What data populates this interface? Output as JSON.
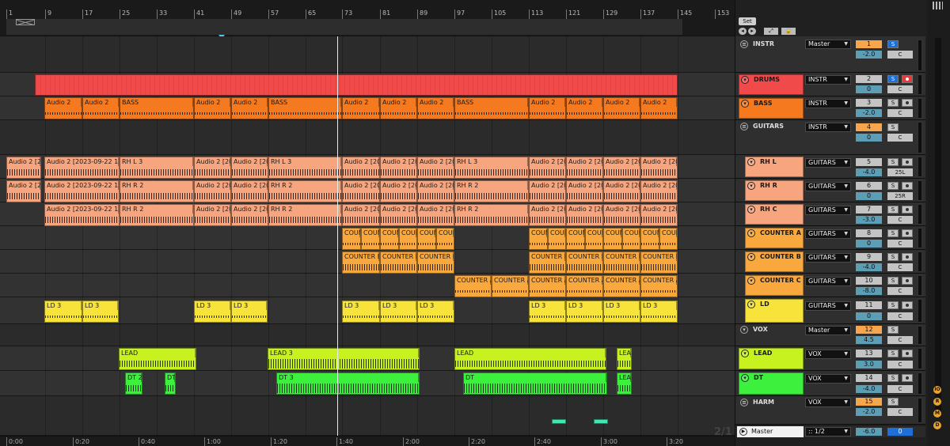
{
  "ruler": {
    "bars": [
      "1",
      "9",
      "17",
      "25",
      "33",
      "41",
      "49",
      "57",
      "65",
      "73",
      "81",
      "89",
      "97",
      "105",
      "113",
      "121",
      "129",
      "137",
      "145",
      "153"
    ]
  },
  "timebar": {
    "times": [
      "0:00",
      "0:20",
      "0:40",
      "1:00",
      "1:20",
      "1:40",
      "2:00",
      "2:20",
      "2:40",
      "3:00",
      "3:20"
    ]
  },
  "pager": "2/1",
  "controls": {
    "set": "Set",
    "prev": "◂",
    "next": "▸",
    "fit": "⤢",
    "lock": "🔒"
  },
  "clips": {
    "audio2": "Audio 2",
    "bass": "BASS",
    "audio2_short": "Audio 2 [2",
    "audio2_date": "Audio 2 [2023-09-22 13",
    "audio2_20": "Audio 2 [20",
    "audio2_20x": "Audio 2 [20",
    "rhl3": "RH L 3",
    "rhr2": "RH R 2",
    "coun": "COUN",
    "counb": "COUNTER B",
    "countera": "COUNTER A",
    "ld3": "LD 3",
    "lead": "LEAD",
    "lead3": "LEAD 3",
    "lea": "LEA",
    "dt2": "DT 2",
    "dt": "DT",
    "dt3": "DT 3"
  },
  "tracks": [
    {
      "name": "INSTR",
      "group": true,
      "color": "#3a3a3a",
      "route": "Master",
      "num": "1",
      "vol": "-2.0",
      "pan": "C",
      "solo_on": true,
      "arm": false
    },
    {
      "name": "DRUMS",
      "group": false,
      "color": "#f04a4a",
      "route": "INSTR",
      "num": "2",
      "vol": "0",
      "pan": "C",
      "solo_on": true,
      "arm": true,
      "rec": true
    },
    {
      "name": "BASS",
      "group": false,
      "color": "#f57a1f",
      "route": "INSTR",
      "num": "3",
      "vol": "-2.0",
      "pan": "C",
      "solo_on": false,
      "arm": true
    },
    {
      "name": "GUITARS",
      "group": true,
      "color": "#3a3a3a",
      "route": "INSTR",
      "num": "4",
      "vol": "0",
      "pan": "C",
      "solo_on": false,
      "arm": false
    },
    {
      "name": "RH L",
      "group": false,
      "color": "#f7a57e",
      "route": "GUITARS",
      "num": "5",
      "vol": "-4.0",
      "pan": "25L",
      "solo_on": false,
      "arm": true
    },
    {
      "name": "RH R",
      "group": false,
      "color": "#f7a57e",
      "route": "GUITARS",
      "num": "6",
      "vol": "0",
      "pan": "25R",
      "solo_on": false,
      "arm": true
    },
    {
      "name": "RH C",
      "group": false,
      "color": "#f7a57e",
      "route": "GUITARS",
      "num": "7",
      "vol": "-3.0",
      "pan": "C",
      "solo_on": false,
      "arm": true
    },
    {
      "name": "COUNTER A",
      "group": false,
      "color": "#f9a83d",
      "route": "GUITARS",
      "num": "8",
      "vol": "0",
      "pan": "C",
      "solo_on": false,
      "arm": true
    },
    {
      "name": "COUNTER B",
      "group": false,
      "color": "#f9a83d",
      "route": "GUITARS",
      "num": "9",
      "vol": "-4.0",
      "pan": "C",
      "solo_on": false,
      "arm": true
    },
    {
      "name": "COUNTER C",
      "group": false,
      "color": "#f9a83d",
      "route": "GUITARS",
      "num": "10",
      "vol": "-8.0",
      "pan": "C",
      "solo_on": false,
      "arm": true
    },
    {
      "name": "LD",
      "group": false,
      "color": "#f7e33a",
      "route": "GUITARS",
      "num": "11",
      "vol": "0",
      "pan": "C",
      "solo_on": false,
      "arm": true
    },
    {
      "name": "VOX",
      "group": true,
      "color": "#3a3a3a",
      "route": "Master",
      "num": "12",
      "vol": "4.5",
      "pan": "C",
      "solo_on": false,
      "arm": false
    },
    {
      "name": "LEAD",
      "group": false,
      "color": "#c7f21f",
      "route": "VOX",
      "num": "13",
      "vol": "3.0",
      "pan": "C",
      "solo_on": false,
      "arm": true
    },
    {
      "name": "DT",
      "group": false,
      "color": "#3df03d",
      "route": "VOX",
      "num": "14",
      "vol": "-4.0",
      "pan": "C",
      "solo_on": false,
      "arm": true
    },
    {
      "name": "HARM",
      "group": true,
      "color": "#3a3a3a",
      "route": "VOX",
      "num": "15",
      "vol": "-2.0",
      "pan": "C",
      "solo_on": false,
      "arm": false
    }
  ],
  "master": {
    "name": "Master",
    "quant": ":: 1/2",
    "vol": "-6.0",
    "num": "0"
  },
  "side_buttons": [
    "IO",
    "R",
    "M",
    "D"
  ]
}
